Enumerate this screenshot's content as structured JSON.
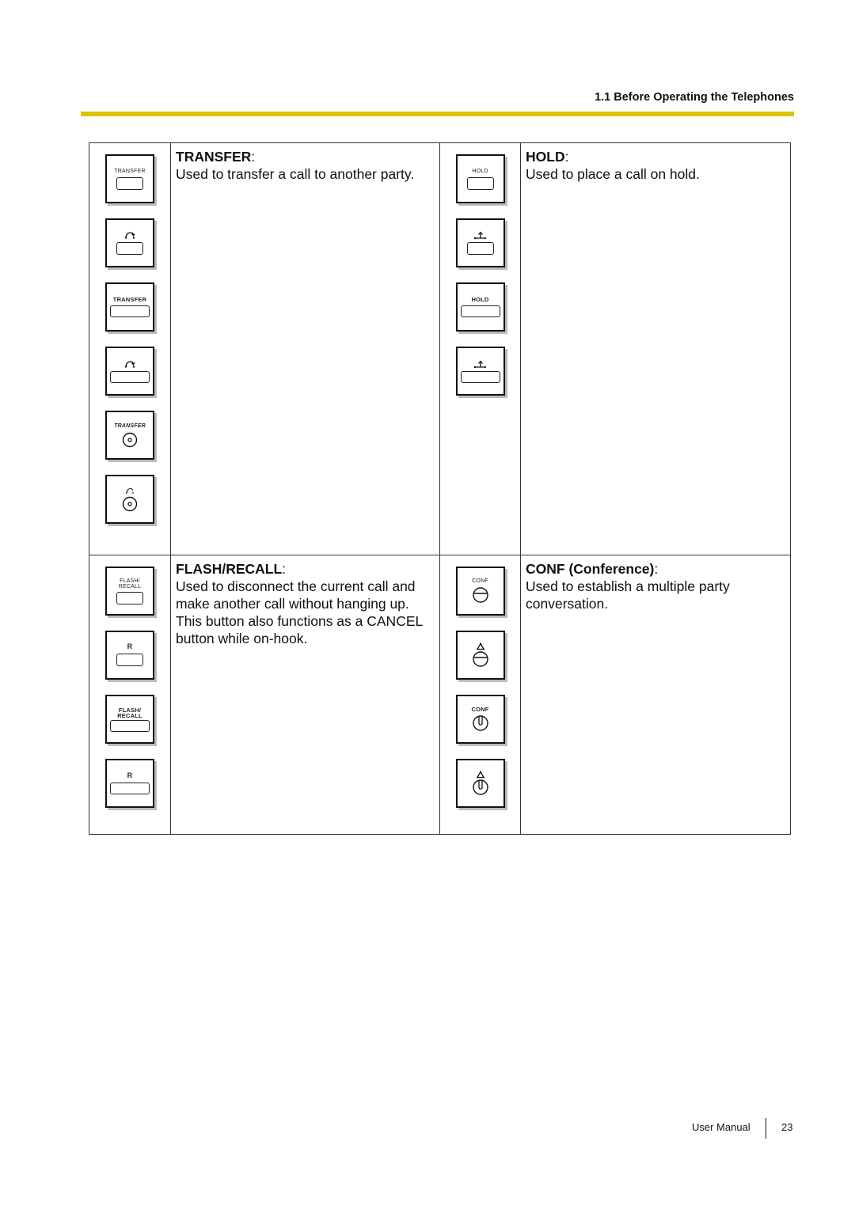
{
  "header": {
    "section_title": "1.1 Before Operating the Telephones",
    "rule_color": "#dcc300"
  },
  "features": {
    "transfer": {
      "title": "TRANSFER",
      "colon": ":",
      "description": "Used to transfer a call to another party.",
      "key_labels": [
        "TRANSFER",
        "transfer-arrow-icon",
        "TRANSFER",
        "transfer-arrow-icon",
        "TRANSFER",
        "transfer-arrow-icon"
      ]
    },
    "hold": {
      "title": "HOLD",
      "colon": ":",
      "description": "Used to place a call on hold.",
      "key_labels": [
        "HOLD",
        "hold-arrow-icon",
        "HOLD",
        "hold-arrow-icon"
      ]
    },
    "flash_recall": {
      "title": "FLASH/RECALL",
      "colon": ":",
      "description_lines": [
        "Used to disconnect the current call and",
        "make another call without hanging up.",
        "This button also functions as a CANCEL",
        "button while on-hook."
      ],
      "key_labels": [
        "FLASH/\nRECALL",
        "R",
        "FLASH/\nRECALL",
        "R"
      ]
    },
    "conf": {
      "title": "CONF (Conference)",
      "colon": ":",
      "description_lines": [
        "Used to establish a multiple party",
        "conversation."
      ],
      "key_labels": [
        "CONF",
        "conference-triangle-icon",
        "CONF",
        "conference-triangle-icon"
      ]
    }
  },
  "keys": {
    "transfer_label": "TRANSFER",
    "hold_label": "HOLD",
    "flash_line1": "FLASH/",
    "flash_line2": "RECALL",
    "r_label": "R",
    "conf_label": "CONF"
  },
  "footer": {
    "label": "User Manual",
    "page_number": "23"
  }
}
